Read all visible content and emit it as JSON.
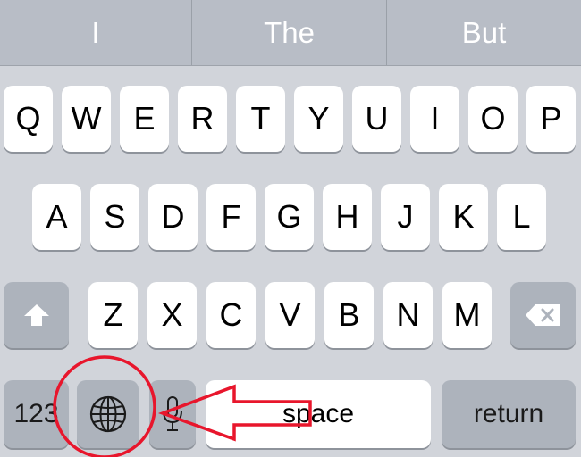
{
  "suggestions": [
    "I",
    "The",
    "But"
  ],
  "rows": {
    "row1": [
      "Q",
      "W",
      "E",
      "R",
      "T",
      "Y",
      "U",
      "I",
      "O",
      "P"
    ],
    "row2": [
      "A",
      "S",
      "D",
      "F",
      "G",
      "H",
      "J",
      "K",
      "L"
    ],
    "row3": [
      "Z",
      "X",
      "C",
      "V",
      "B",
      "N",
      "M"
    ]
  },
  "bottom": {
    "numbers_label": "123",
    "space_label": "space",
    "return_label": "return"
  },
  "icons": {
    "shift": "shift-arrow-icon",
    "delete": "backspace-icon",
    "globe": "globe-icon",
    "mic": "microphone-icon"
  },
  "annotation": {
    "color": "#e8162c"
  },
  "colors": {
    "keyboard_bg": "#d1d4da",
    "suggestion_bg": "#b8bdc6",
    "key_bg": "#ffffff",
    "special_key_bg": "#adb3bc"
  }
}
